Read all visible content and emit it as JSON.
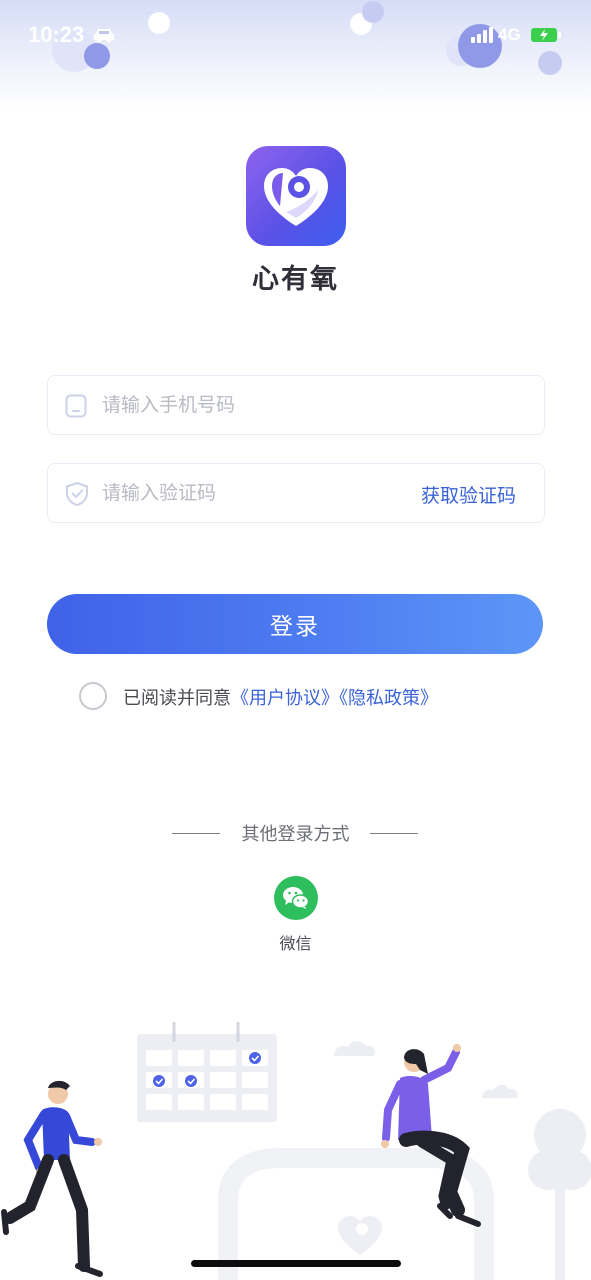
{
  "status_bar": {
    "time": "10:23",
    "network": "4G",
    "icons": [
      "car-icon",
      "signal-icon",
      "battery-charging-icon"
    ]
  },
  "app": {
    "name": "心有氧",
    "logo": "heart-logo-icon",
    "brand_gradient": [
      "#8f63ee",
      "#3c5ef0"
    ]
  },
  "form": {
    "phone": {
      "placeholder": "请输入手机号码",
      "value": "",
      "icon": "phone-icon"
    },
    "code": {
      "placeholder": "请输入验证码",
      "value": "",
      "icon": "shield-icon",
      "get_code_label": "获取验证码"
    },
    "login_label": "登录"
  },
  "agreement": {
    "checked": false,
    "prefix": "已阅读并同意",
    "user_agreement": "《用户协议》",
    "privacy_policy": "《隐私政策》"
  },
  "other_login": {
    "title": "其他登录方式",
    "options": [
      {
        "label": "微信",
        "icon": "wechat-icon",
        "color": "#2fbe5d"
      }
    ]
  },
  "colors": {
    "accent": "#3a63d8",
    "button_gradient": [
      "#3f62e8",
      "#5d96f7"
    ]
  }
}
